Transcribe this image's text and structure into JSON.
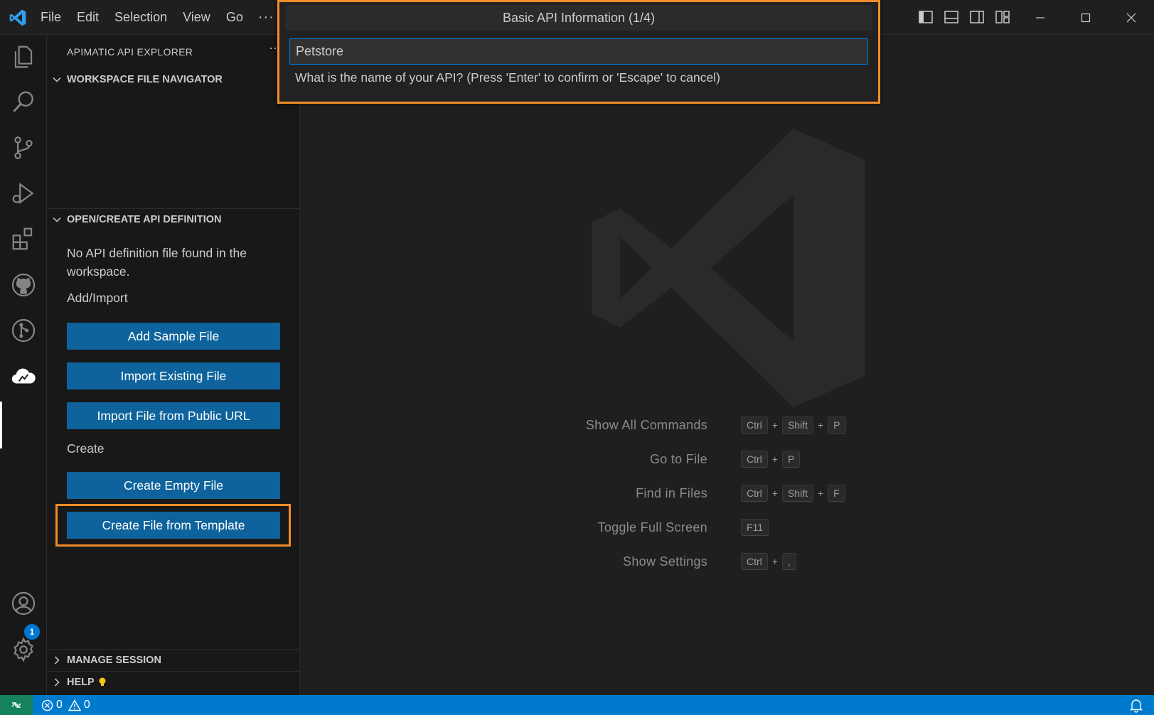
{
  "menu": {
    "items": [
      "File",
      "Edit",
      "Selection",
      "View",
      "Go"
    ],
    "more": "···"
  },
  "sidebar": {
    "title": "APIMATIC API EXPLORER",
    "more": "···",
    "sections": {
      "workspace": "WORKSPACE FILE NAVIGATOR",
      "open_create": "OPEN/CREATE API DEFINITION",
      "manage_session": "MANAGE SESSION",
      "help": "HELP"
    },
    "message": "No API definition file found in the workspace.",
    "add_import_label": "Add/Import",
    "create_label": "Create",
    "buttons": {
      "add_sample": "Add Sample File",
      "import_existing": "Import Existing File",
      "import_url": "Import File from Public URL",
      "create_empty": "Create Empty File",
      "create_template": "Create File from Template"
    }
  },
  "accounts_badge": "1",
  "quick_input": {
    "title": "Basic API Information (1/4)",
    "value": "Petstore",
    "hint": "What is the name of your API? (Press 'Enter' to confirm or 'Escape' to cancel)"
  },
  "shortcuts": [
    {
      "label": "Show All Commands",
      "keys": [
        "Ctrl",
        "Shift",
        "P"
      ]
    },
    {
      "label": "Go to File",
      "keys": [
        "Ctrl",
        "P"
      ]
    },
    {
      "label": "Find in Files",
      "keys": [
        "Ctrl",
        "Shift",
        "F"
      ]
    },
    {
      "label": "Toggle Full Screen",
      "keys": [
        "F11"
      ]
    },
    {
      "label": "Show Settings",
      "keys": [
        "Ctrl",
        ","
      ]
    }
  ],
  "status": {
    "errors": "0",
    "warnings": "0"
  },
  "colors": {
    "accent": "#0078d4",
    "button": "#0e639c",
    "status_bar": "#007acc",
    "remote": "#16825d",
    "highlight": "#f28c28"
  }
}
